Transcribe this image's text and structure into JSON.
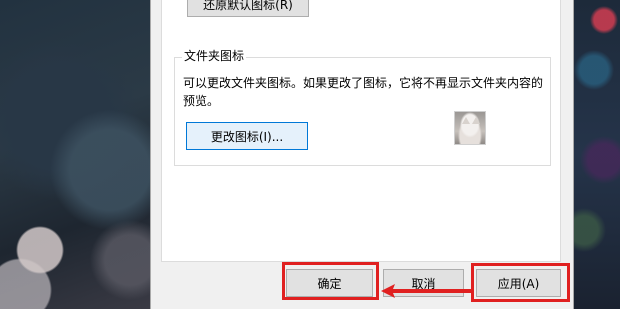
{
  "dialog": {
    "restore_default_label": "还原默认图标(R)",
    "folder_icon_group": {
      "title": "文件夹图标",
      "description": "可以更改文件夹图标。如果更改了图标，它将不再显示文件夹内容的预览。",
      "change_icon_label": "更改图标(I)..."
    },
    "buttons": {
      "ok": "确定",
      "cancel": "取消",
      "apply": "应用(A)"
    }
  },
  "annotation": {
    "highlight_color": "#e02020",
    "arrow_color": "#e02020"
  },
  "icons": {
    "folder_preview": "cat-thumbnail-icon"
  }
}
